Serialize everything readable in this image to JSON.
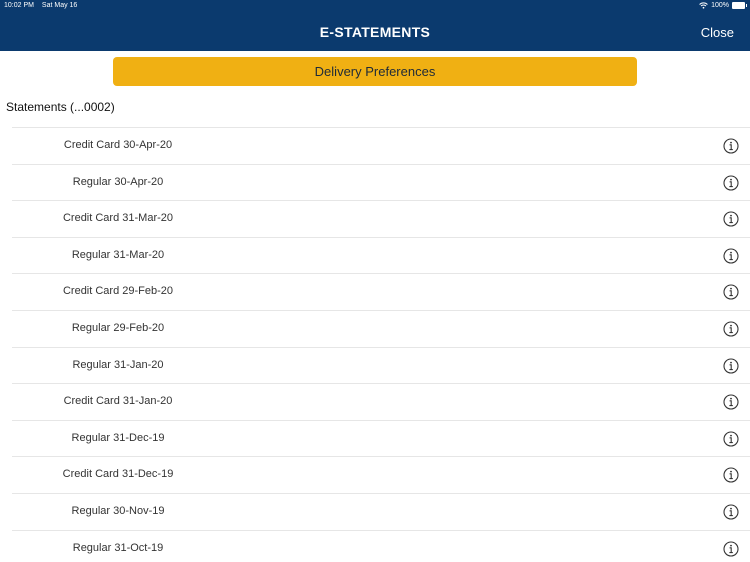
{
  "status_bar": {
    "time": "10:02 PM",
    "date": "Sat May 16",
    "battery": "100%",
    "icons": [
      "wifi-icon",
      "battery-icon"
    ]
  },
  "header": {
    "title": "E-STATEMENTS",
    "close_label": "Close"
  },
  "delivery_preferences_label": "Delivery Preferences",
  "section_label": "Statements  (...0002)",
  "statements": [
    {
      "label": "Credit Card 30-Apr-20"
    },
    {
      "label": "Regular 30-Apr-20"
    },
    {
      "label": "Credit Card 31-Mar-20"
    },
    {
      "label": "Regular 31-Mar-20"
    },
    {
      "label": "Credit Card 29-Feb-20"
    },
    {
      "label": "Regular 29-Feb-20"
    },
    {
      "label": "Regular 31-Jan-20"
    },
    {
      "label": "Credit Card 31-Jan-20"
    },
    {
      "label": "Regular 31-Dec-19"
    },
    {
      "label": "Credit Card 31-Dec-19"
    },
    {
      "label": "Regular 30-Nov-19"
    },
    {
      "label": "Regular 31-Oct-19"
    }
  ],
  "row_icon": "info-icon",
  "colors": {
    "header_bg": "#0b3a6e",
    "button_bg": "#f0b013",
    "divider": "#e6e6e6"
  }
}
